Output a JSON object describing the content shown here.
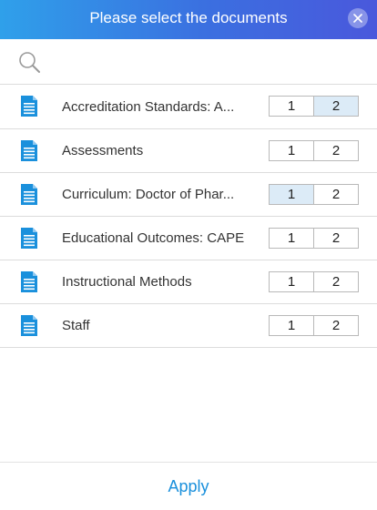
{
  "dialog": {
    "title": "Please select the documents",
    "close_icon": "close-icon"
  },
  "search": {
    "icon": "search-icon",
    "placeholder": "",
    "value": ""
  },
  "documents": [
    {
      "name": "Accreditation Standards: A...",
      "icon": "document-icon",
      "versions": [
        {
          "label": "1",
          "selected": false
        },
        {
          "label": "2",
          "selected": true
        }
      ]
    },
    {
      "name": "Assessments",
      "icon": "document-icon",
      "versions": [
        {
          "label": "1",
          "selected": false
        },
        {
          "label": "2",
          "selected": false
        }
      ]
    },
    {
      "name": "Curriculum: Doctor of Phar...",
      "icon": "document-icon",
      "versions": [
        {
          "label": "1",
          "selected": true
        },
        {
          "label": "2",
          "selected": false
        }
      ]
    },
    {
      "name": "Educational Outcomes: CAPE",
      "icon": "document-icon",
      "versions": [
        {
          "label": "1",
          "selected": false
        },
        {
          "label": "2",
          "selected": false
        }
      ]
    },
    {
      "name": "Instructional Methods",
      "icon": "document-icon",
      "versions": [
        {
          "label": "1",
          "selected": false
        },
        {
          "label": "2",
          "selected": false
        }
      ]
    },
    {
      "name": "Staff",
      "icon": "document-icon",
      "versions": [
        {
          "label": "1",
          "selected": false
        },
        {
          "label": "2",
          "selected": false
        }
      ]
    }
  ],
  "footer": {
    "apply_label": "Apply"
  },
  "colors": {
    "header_start": "#2fa0ea",
    "header_end": "#4a58dc",
    "accent": "#1a90dc",
    "doc_icon": "#1a90dc",
    "selected_version_bg": "#dcebf7"
  }
}
